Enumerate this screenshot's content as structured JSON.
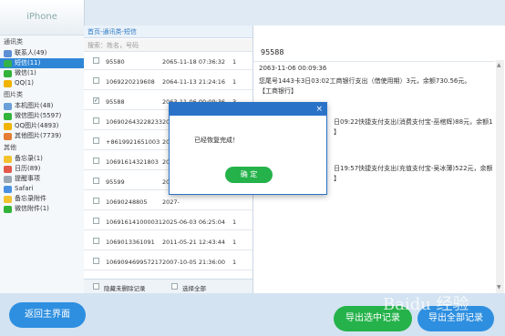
{
  "sidebar": {
    "title": "iPhone",
    "categories": [
      {
        "label": "通讯类",
        "items": [
          {
            "label": "联系人(49)",
            "icon": "contacts-icon",
            "color": "#5b8fd6"
          },
          {
            "label": "短信(11)",
            "icon": "sms-icon",
            "color": "#34b24a",
            "selected": true
          },
          {
            "label": "微信(1)",
            "icon": "wechat-icon",
            "color": "#32b33a"
          },
          {
            "label": "QQ(1)",
            "icon": "qq-icon",
            "color": "#f0b400"
          }
        ]
      },
      {
        "label": "图片类",
        "items": [
          {
            "label": "本机图片(48)",
            "icon": "photo-icon",
            "color": "#6a9fd8"
          },
          {
            "label": "微信图片(5597)",
            "icon": "wechat-photo-icon",
            "color": "#32b33a"
          },
          {
            "label": "QQ图片(4893)",
            "icon": "qq-photo-icon",
            "color": "#f0b400"
          },
          {
            "label": "其他图片(7739)",
            "icon": "other-photo-icon",
            "color": "#e67c35"
          }
        ]
      },
      {
        "label": "其他",
        "items": [
          {
            "label": "备忘录(1)",
            "icon": "memo-icon",
            "color": "#f2c230"
          },
          {
            "label": "日历(89)",
            "icon": "calendar-icon",
            "color": "#e45a4a"
          },
          {
            "label": "提醒事项",
            "icon": "reminder-icon",
            "color": "#9aa7b5"
          },
          {
            "label": "Safari",
            "icon": "safari-icon",
            "color": "#4a90e2"
          },
          {
            "label": "备忘录附件",
            "icon": "memo-attachment-icon",
            "color": "#f2c230"
          },
          {
            "label": "微信附件(1)",
            "icon": "wechat-attachment-icon",
            "color": "#32b33a"
          }
        ]
      }
    ]
  },
  "breadcrumb": "首页-通讯类-短信",
  "search_placeholder": "搜索：姓名，号码",
  "rows": [
    {
      "number": "95580",
      "date": "2065-11-18 07:36:32",
      "count": "1",
      "checked": false
    },
    {
      "number": "1069220219608",
      "date": "2064-11-13 21:24:16",
      "count": "1",
      "checked": false
    },
    {
      "number": "95588",
      "date": "2063-11-06 00:09:36",
      "count": "3",
      "checked": true
    },
    {
      "number": "106902643228233",
      "date": "2060-11-21 09:10:51",
      "count": "1",
      "checked": false
    },
    {
      "number": "+8619921651003",
      "date": "2056-",
      "count": "",
      "checked": false
    },
    {
      "number": "10691614321803",
      "date": "2040-",
      "count": "",
      "checked": false
    },
    {
      "number": "95599",
      "date": "2028-",
      "count": "",
      "checked": false
    },
    {
      "number": "10690248805",
      "date": "2027-",
      "count": "",
      "checked": false
    },
    {
      "number": "106916141000031",
      "date": "2025-06-03 06:25:04",
      "count": "1",
      "checked": false
    },
    {
      "number": "1069013361091",
      "date": "2011-05-21 12:43:44",
      "count": "1",
      "checked": false
    },
    {
      "number": "106909469957217",
      "date": "2007-10-05 21:36:00",
      "count": "1",
      "checked": false
    }
  ],
  "list_footer": {
    "hide_deleted": "隐藏未删除记录",
    "select_all": "选择全部"
  },
  "detail": {
    "contact": "95588",
    "timestamp": "2063-11-06 00:09:36",
    "messages": [
      {
        "lines": [
          "您尾号1443卡3日03:02工商银行支出（借使用期）3元，余额730.56元。",
          "【工商银行】"
        ]
      },
      {
        "lines": [
          "日09:22快捷支付支出(消费支付宝-巫棺辉)88元，余额1",
          "】"
        ]
      },
      {
        "lines": [
          "日19:57快捷支付支出(充值支付宝-吴冰薄)522元，余额",
          "】"
        ]
      }
    ]
  },
  "buttons": {
    "back": "返回主界面",
    "export_selected": "导出选中记录",
    "export_all": "导出全部记录"
  },
  "modal": {
    "message": "已经恢复完成！",
    "ok": "确 定",
    "close": "×"
  },
  "watermark": "Baidu 经验",
  "colors": {
    "accent": "#2a72c8",
    "selected": "#2f86d6",
    "ok": "#25b24b",
    "back": "#2e8fe0"
  }
}
